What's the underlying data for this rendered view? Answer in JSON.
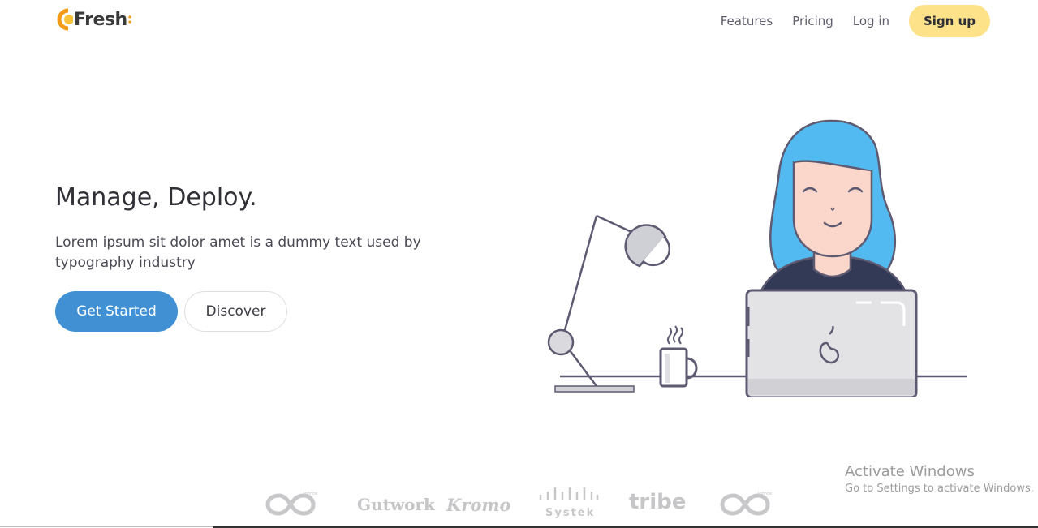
{
  "brand": {
    "name": "Fresh"
  },
  "nav": {
    "links": [
      "Features",
      "Pricing",
      "Log in"
    ],
    "signup_label": "Sign up"
  },
  "hero": {
    "title": "Manage, Deploy.",
    "subtitle": "Lorem ipsum sit dolor amet is a dummy text used by typography industry",
    "primary_cta": "Get Started",
    "secondary_cta": "Discover"
  },
  "clients": {
    "logos": [
      "Infinite",
      "Gutwork",
      "Kromo",
      "Systek",
      "tribe",
      "Infinite"
    ]
  },
  "watermark": {
    "title": "Activate Windows",
    "subtitle": "Go to Settings to activate Windows."
  },
  "colors": {
    "primary": "#4190d4",
    "signup_bg": "#fde28a",
    "hair": "#52baf0",
    "outline": "#5e5a72",
    "laptop": "#e3e3e6"
  }
}
